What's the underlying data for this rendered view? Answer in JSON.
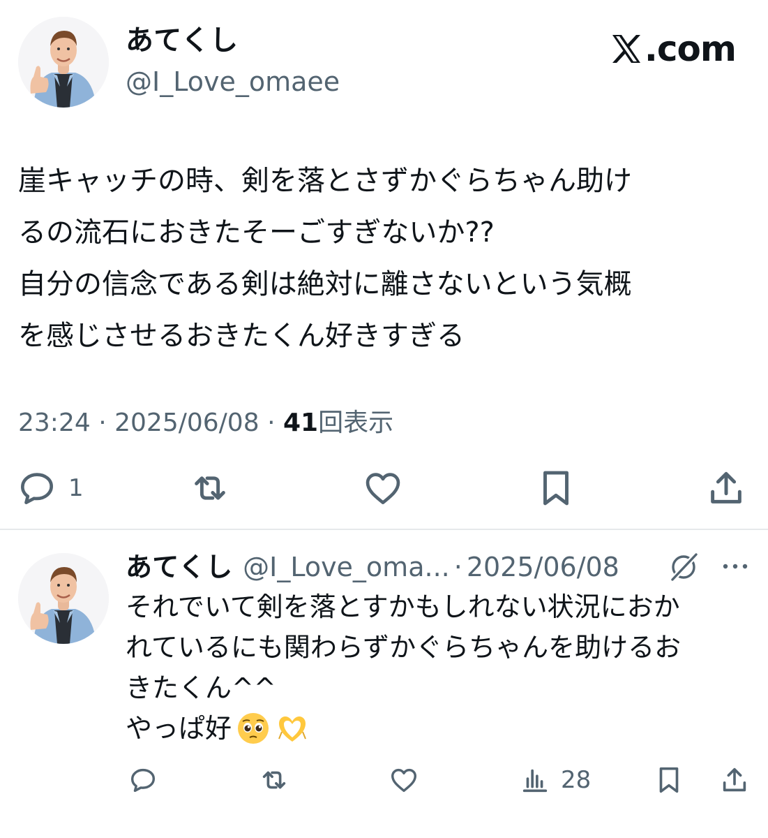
{
  "main_tweet": {
    "author_name": "あてくし",
    "author_handle": "@I_Love_omaee",
    "body_lines": [
      "崖キャッチの時、剣を落とさずかぐらちゃん助け",
      "るの流石におきたそーごすぎないか??",
      "自分の信念である剣は絶対に離さないという気概",
      "を感じさせるおきたくん好きすぎる"
    ],
    "time": "23:24",
    "separator": "·",
    "date": "2025/06/08",
    "views_count": "41",
    "views_label": "回表示",
    "reply_count": "1",
    "avatar_icon": "user-avatar-photo",
    "action_icons": [
      "reply-icon",
      "retweet-icon",
      "like-icon",
      "bookmark-icon",
      "share-icon"
    ]
  },
  "brand": {
    "logo_icon": "x-logo-icon",
    "text": ".com"
  },
  "reply_tweet": {
    "author_name": "あてくし",
    "author_handle": "@I_Love_oma...",
    "separator": "·",
    "date": "2025/06/08",
    "body_lines": [
      "それでいて剣を落とすかもしれない状況におか",
      "れているにも関わらずかぐらちゃんを助けるお",
      "きたくん^^",
      "やっぱ好"
    ],
    "emojis": [
      "pleading-face-emoji",
      "heart-hands-emoji"
    ],
    "views_count": "28",
    "action_icons": [
      "reply-icon",
      "retweet-icon",
      "like-icon",
      "analytics-icon",
      "bookmark-icon",
      "share-icon"
    ],
    "header_icons": [
      "grok-icon",
      "more-icon"
    ]
  },
  "colors": {
    "text_primary": "#0f1419",
    "text_secondary": "#536471",
    "divider": "#e6e9eb",
    "background": "#ffffff"
  }
}
